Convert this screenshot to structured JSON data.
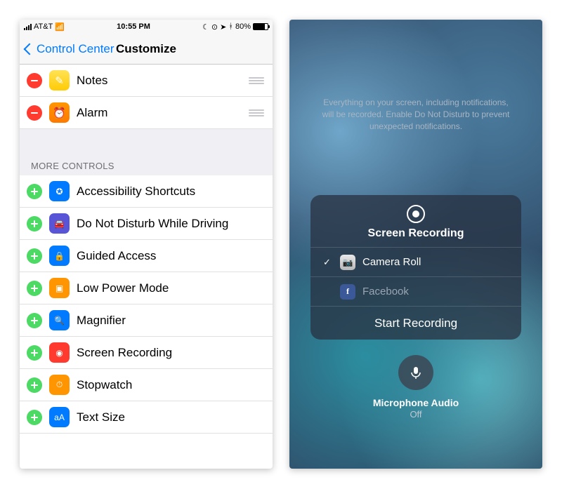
{
  "left": {
    "status": {
      "carrier": "AT&T",
      "time": "10:55 PM",
      "battery_pct": "80%"
    },
    "nav": {
      "back_label": "Control Center",
      "title": "Customize"
    },
    "included": [
      {
        "name": "notes",
        "label": "Notes",
        "icon": "notes-icon",
        "bg": "ic-notes",
        "glyph": "✎"
      },
      {
        "name": "alarm",
        "label": "Alarm",
        "icon": "alarm-icon",
        "bg": "ic-alarm",
        "glyph": "⏰"
      }
    ],
    "more_header": "MORE CONTROLS",
    "more": [
      {
        "name": "accessibility-shortcuts",
        "label": "Accessibility Shortcuts",
        "bg": "ic-access",
        "glyph": "✪"
      },
      {
        "name": "do-not-disturb-while-driving",
        "label": "Do Not Disturb While Driving",
        "bg": "ic-dnd",
        "glyph": "🚘"
      },
      {
        "name": "guided-access",
        "label": "Guided Access",
        "bg": "ic-guided",
        "glyph": "🔒"
      },
      {
        "name": "low-power-mode",
        "label": "Low Power Mode",
        "bg": "ic-power",
        "glyph": "▣"
      },
      {
        "name": "magnifier",
        "label": "Magnifier",
        "bg": "ic-mag",
        "glyph": "🔍"
      },
      {
        "name": "screen-recording",
        "label": "Screen Recording",
        "bg": "ic-rec",
        "glyph": "◉"
      },
      {
        "name": "stopwatch",
        "label": "Stopwatch",
        "bg": "ic-stop",
        "glyph": "⏱"
      },
      {
        "name": "text-size",
        "label": "Text Size",
        "bg": "ic-text",
        "glyph": "aA"
      }
    ]
  },
  "right": {
    "hint": "Everything on your screen, including notifications, will be recorded. Enable Do Not Disturb to prevent unexpected notifications.",
    "panel_title": "Screen Recording",
    "destinations": [
      {
        "name": "camera-roll",
        "label": "Camera Roll",
        "selected": true,
        "icon": "camera-icon",
        "mi": "mi-camera",
        "glyph": "📷"
      },
      {
        "name": "facebook",
        "label": "Facebook",
        "selected": false,
        "icon": "facebook-icon",
        "mi": "mi-fb",
        "glyph": "f"
      }
    ],
    "action_label": "Start Recording",
    "mic_label": "Microphone Audio",
    "mic_state": "Off"
  }
}
